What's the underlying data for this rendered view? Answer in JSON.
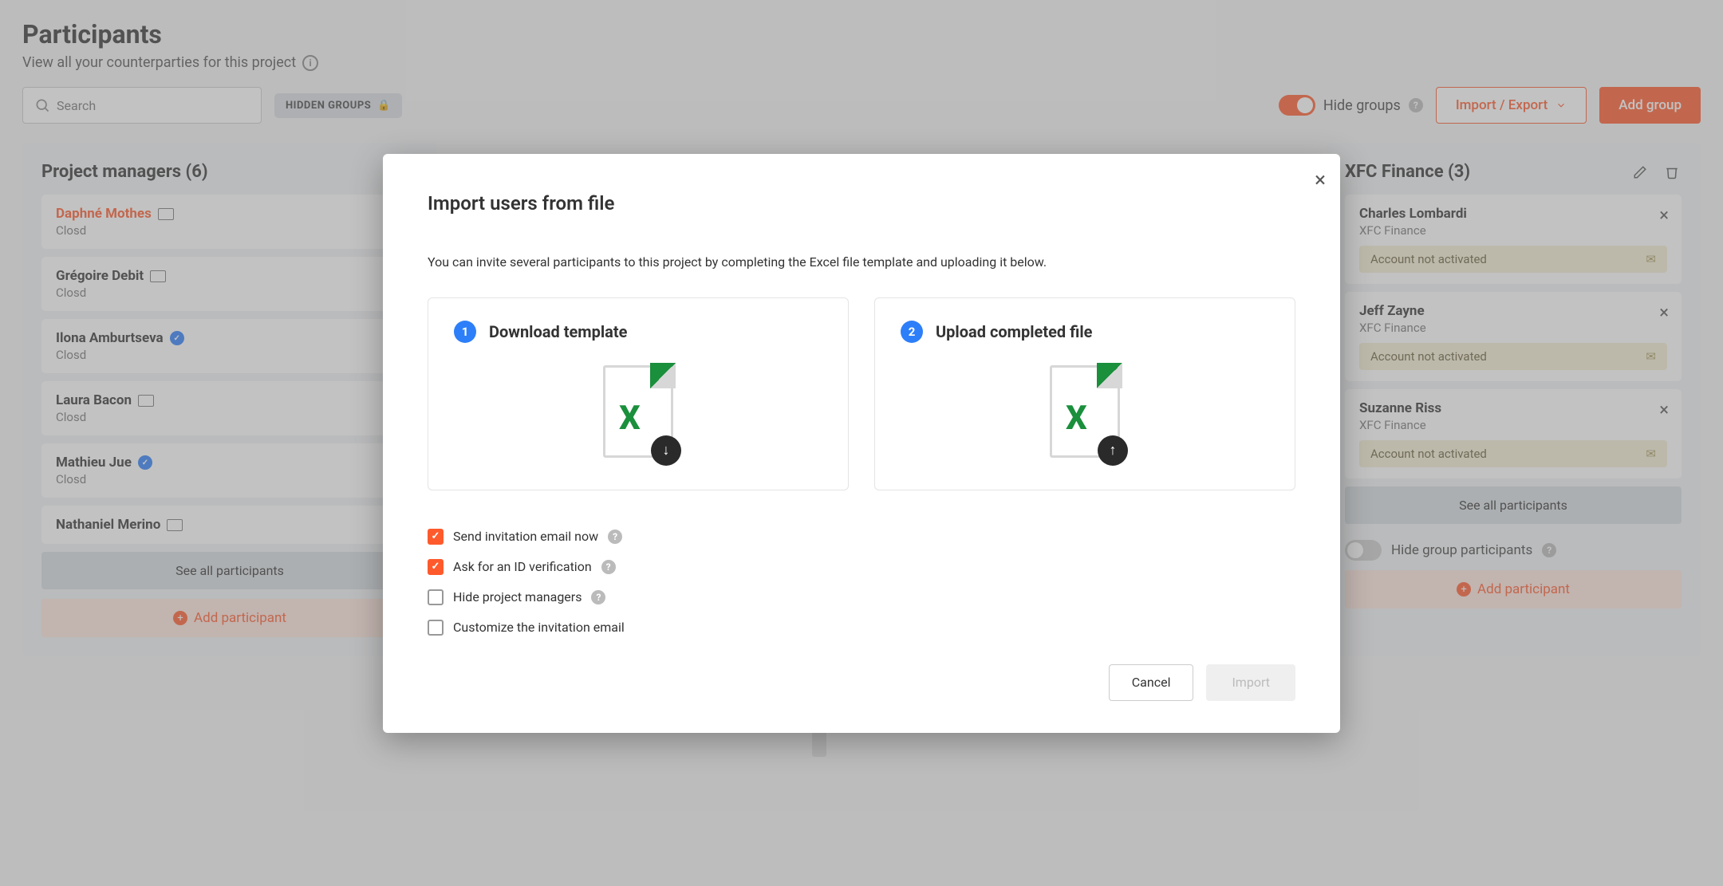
{
  "page": {
    "title": "Participants",
    "subtitle": "View all your counterparties for this project"
  },
  "toolbar": {
    "search_placeholder": "Search",
    "hidden_groups_chip": "HIDDEN GROUPS",
    "hide_groups_label": "Hide groups",
    "import_export_label": "Import / Export",
    "add_group_label": "Add group"
  },
  "groups": {
    "managers": {
      "title": "Project managers (6)",
      "participants": [
        {
          "name": "Daphné Mothes",
          "company": "Closd",
          "me": true,
          "id_badge": true
        },
        {
          "name": "Grégoire Debit",
          "company": "Closd",
          "id_badge": true
        },
        {
          "name": "Ilona Amburtseva",
          "company": "Closd",
          "verified": true
        },
        {
          "name": "Laura Bacon",
          "company": "Closd",
          "id_badge": true
        },
        {
          "name": "Mathieu Jue",
          "company": "Closd",
          "verified": true
        },
        {
          "name": "Nathaniel Merino",
          "company": "",
          "id_badge": true
        }
      ]
    },
    "xfc": {
      "title": "XFC Finance (3)",
      "participants": [
        {
          "name": "Charles Lombardi",
          "company": "XFC Finance",
          "status": "Account not activated"
        },
        {
          "name": "Jeff Zayne",
          "company": "XFC Finance",
          "status": "Account not activated"
        },
        {
          "name": "Suzanne Riss",
          "company": "XFC Finance",
          "status": "Account not activated"
        }
      ],
      "hide_participants_label": "Hide group participants"
    },
    "see_all_label": "See all participants",
    "add_participant_label": "Add participant"
  },
  "modal": {
    "title": "Import users from file",
    "description": "You can invite several participants to this project by completing the Excel file template and uploading it below.",
    "step1_title": "Download template",
    "step2_title": "Upload completed file",
    "options": {
      "send_invitation": "Send invitation email now",
      "ask_id": "Ask for an ID verification",
      "hide_managers": "Hide project managers",
      "customize_email": "Customize the invitation email"
    },
    "cancel_label": "Cancel",
    "import_label": "Import"
  }
}
